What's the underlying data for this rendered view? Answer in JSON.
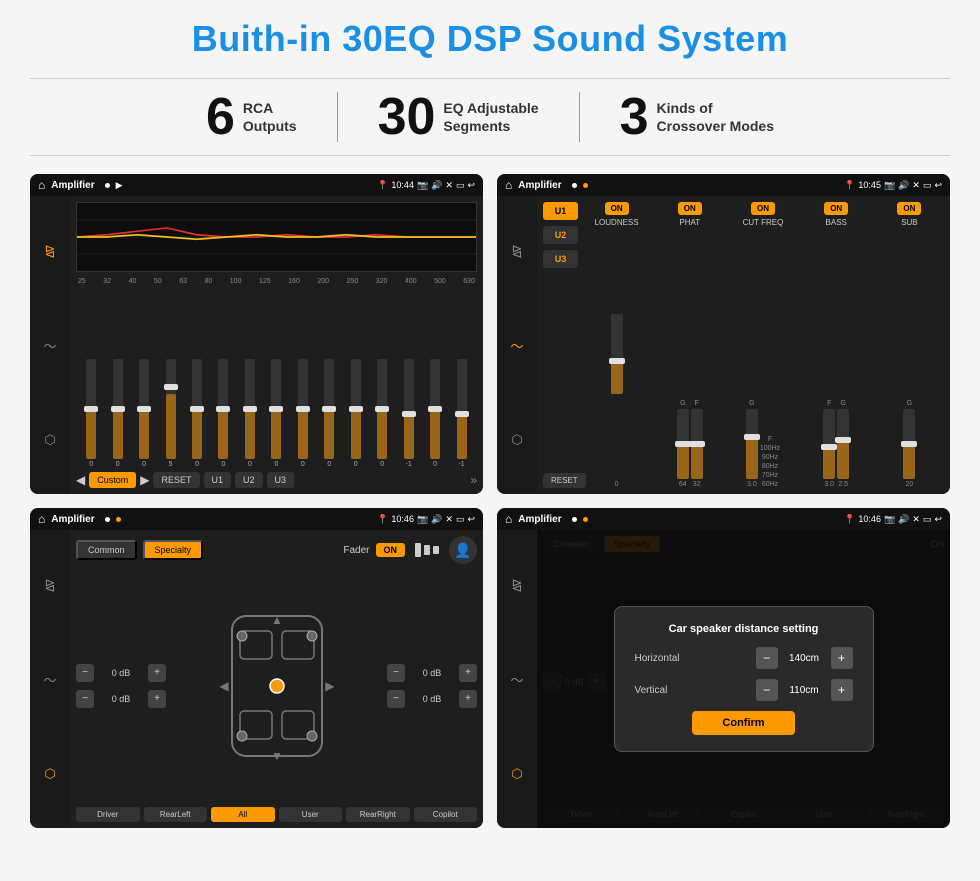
{
  "page": {
    "title": "Buith-in 30EQ DSP Sound System",
    "stats": [
      {
        "number": "6",
        "label": "RCA\nOutputs"
      },
      {
        "number": "30",
        "label": "EQ Adjustable\nSegments"
      },
      {
        "number": "3",
        "label": "Kinds of\nCrossover Modes"
      }
    ],
    "screens": [
      {
        "id": "eq-screen",
        "statusBar": {
          "appName": "Amplifier",
          "time": "10:44"
        }
      },
      {
        "id": "crossover-screen",
        "statusBar": {
          "appName": "Amplifier",
          "time": "10:45"
        }
      },
      {
        "id": "fader-screen",
        "statusBar": {
          "appName": "Amplifier",
          "time": "10:46"
        }
      },
      {
        "id": "dialog-screen",
        "statusBar": {
          "appName": "Amplifier",
          "time": "10:46"
        },
        "dialog": {
          "title": "Car speaker distance setting",
          "horizontal": {
            "label": "Horizontal",
            "value": "140cm"
          },
          "vertical": {
            "label": "Vertical",
            "value": "110cm"
          },
          "confirmLabel": "Confirm"
        }
      }
    ],
    "eq": {
      "freqLabels": [
        "25",
        "32",
        "40",
        "50",
        "63",
        "80",
        "100",
        "125",
        "160",
        "200",
        "250",
        "320",
        "400",
        "500",
        "630"
      ],
      "sliderValues": [
        0,
        0,
        0,
        5,
        0,
        0,
        0,
        0,
        0,
        0,
        0,
        0,
        -1,
        0,
        -1
      ],
      "bottomBtns": [
        "Custom",
        "RESET",
        "U1",
        "U2",
        "U3"
      ]
    },
    "crossover": {
      "presets": [
        "U1",
        "U2",
        "U3"
      ],
      "sections": [
        "LOUDNESS",
        "PHAT",
        "CUT FREQ",
        "BASS",
        "SUB"
      ],
      "resetLabel": "RESET"
    },
    "fader": {
      "tabs": [
        "Common",
        "Specialty"
      ],
      "faderLabel": "Fader",
      "onLabel": "ON",
      "volumes": [
        "-  0 dB  +",
        "-  0 dB  +",
        "-  0 dB  +",
        "-  0 dB  +"
      ],
      "bottomBtns": [
        "Driver",
        "RearLeft",
        "All",
        "User",
        "RearRight",
        "Copilot"
      ]
    },
    "dialog": {
      "title": "Car speaker distance setting",
      "horizontalLabel": "Horizontal",
      "horizontalValue": "140cm",
      "verticalLabel": "Vertical",
      "verticalValue": "110cm",
      "confirmLabel": "Confirm"
    }
  }
}
